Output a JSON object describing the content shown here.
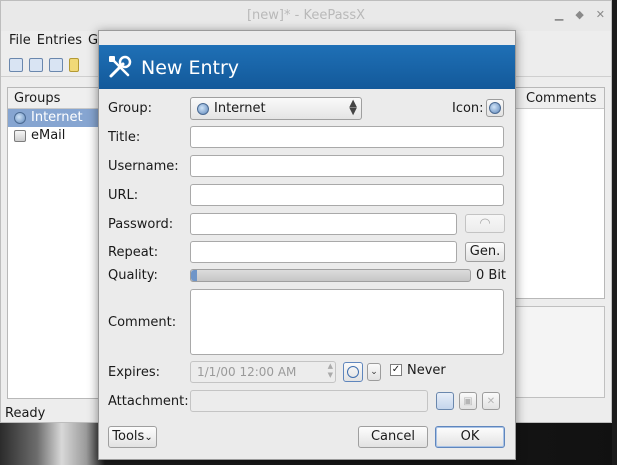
{
  "main_window": {
    "title": "[new]* - KeePassX",
    "menu": [
      "File",
      "Entries",
      "G"
    ],
    "groups_header": "Groups",
    "groups": [
      {
        "label": "Internet",
        "icon": "globe-icon",
        "selected": true
      },
      {
        "label": "eMail",
        "icon": "mail-icon",
        "selected": false
      }
    ],
    "entries_column": "Comments",
    "status": "Ready"
  },
  "dialog": {
    "title": "New Entry",
    "group_label": "Group:",
    "group_value": "Internet",
    "icon_label": "Icon:",
    "title_label": "Title:",
    "username_label": "Username:",
    "url_label": "URL:",
    "password_label": "Password:",
    "repeat_label": "Repeat:",
    "gen_button": "Gen.",
    "quality_label": "Quality:",
    "quality_value": "0 Bit",
    "quality_fraction": 0.01,
    "comment_label": "Comment:",
    "expires_label": "Expires:",
    "expires_value": "1/1/00 12:00 AM",
    "never_label": "Never",
    "never_checked": true,
    "attachment_label": "Attachment:",
    "tools_button": "Tools",
    "cancel_button": "Cancel",
    "ok_button": "OK"
  },
  "colors": {
    "banner": "#1764a8",
    "selection": "#86a5d1"
  }
}
